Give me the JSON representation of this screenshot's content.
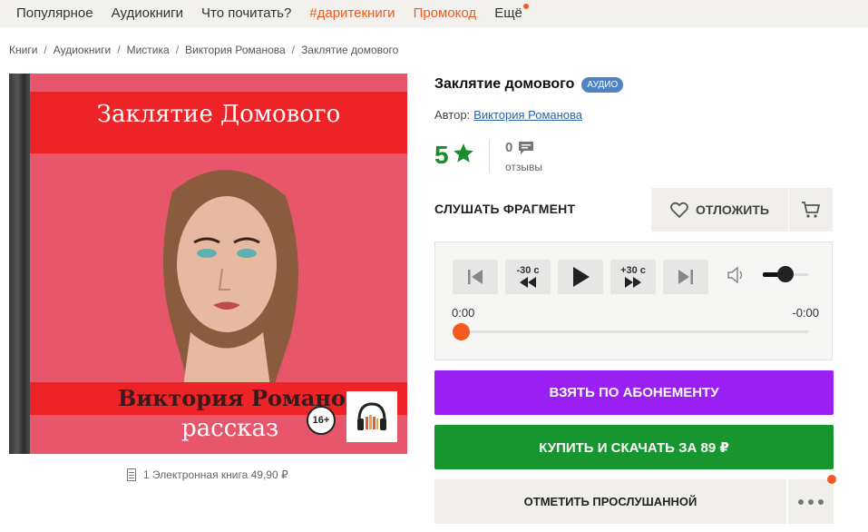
{
  "nav": {
    "items": [
      {
        "label": "Популярное"
      },
      {
        "label": "Аудиокниги"
      },
      {
        "label": "Что почитать?"
      },
      {
        "label": "#даритекниги"
      },
      {
        "label": "Промокод"
      },
      {
        "label": "Ещё"
      }
    ],
    "accent_color": "#f25a1e"
  },
  "breadcrumb": [
    "Книги",
    "Аудиокниги",
    "Мистика",
    "Виктория Романова",
    "Заклятие домового"
  ],
  "cover": {
    "title_art": "Заклятие Домового",
    "author_art": "Виктория Романова",
    "subtitle_art": "рассказ",
    "age_rating": "16+",
    "audio_icon": "headphones-icon"
  },
  "edition_info": "1 Электронная книга 49,90 ₽",
  "book": {
    "title": "Заклятие домового",
    "badge": "АУДИО",
    "author_label": "Автор:",
    "author_name": "Виктория Романова",
    "rating": "5",
    "reviews_count": "0",
    "reviews_label": "отзывы"
  },
  "actions": {
    "listen_fragment": "СЛУШАТЬ ФРАГМЕНТ",
    "postpone": "ОТЛОЖИТЬ",
    "subscribe": "ВЗЯТЬ ПО АБОНЕМЕНТУ",
    "buy": "КУПИТЬ И СКАЧАТЬ ЗА 89 ₽",
    "mark_listened": "ОТМЕТИТЬ ПРОСЛУШАННОЙ"
  },
  "player": {
    "skip_back": "-30 с",
    "skip_forward": "+30 с",
    "time_current": "0:00",
    "time_remaining": "-0:00",
    "progress": 0,
    "volume": 0.5
  },
  "colors": {
    "rating_green": "#1c8c2a",
    "subscribe_purple": "#9a1ff2",
    "buy_green": "#17962f",
    "badge_blue": "#5083c4"
  }
}
